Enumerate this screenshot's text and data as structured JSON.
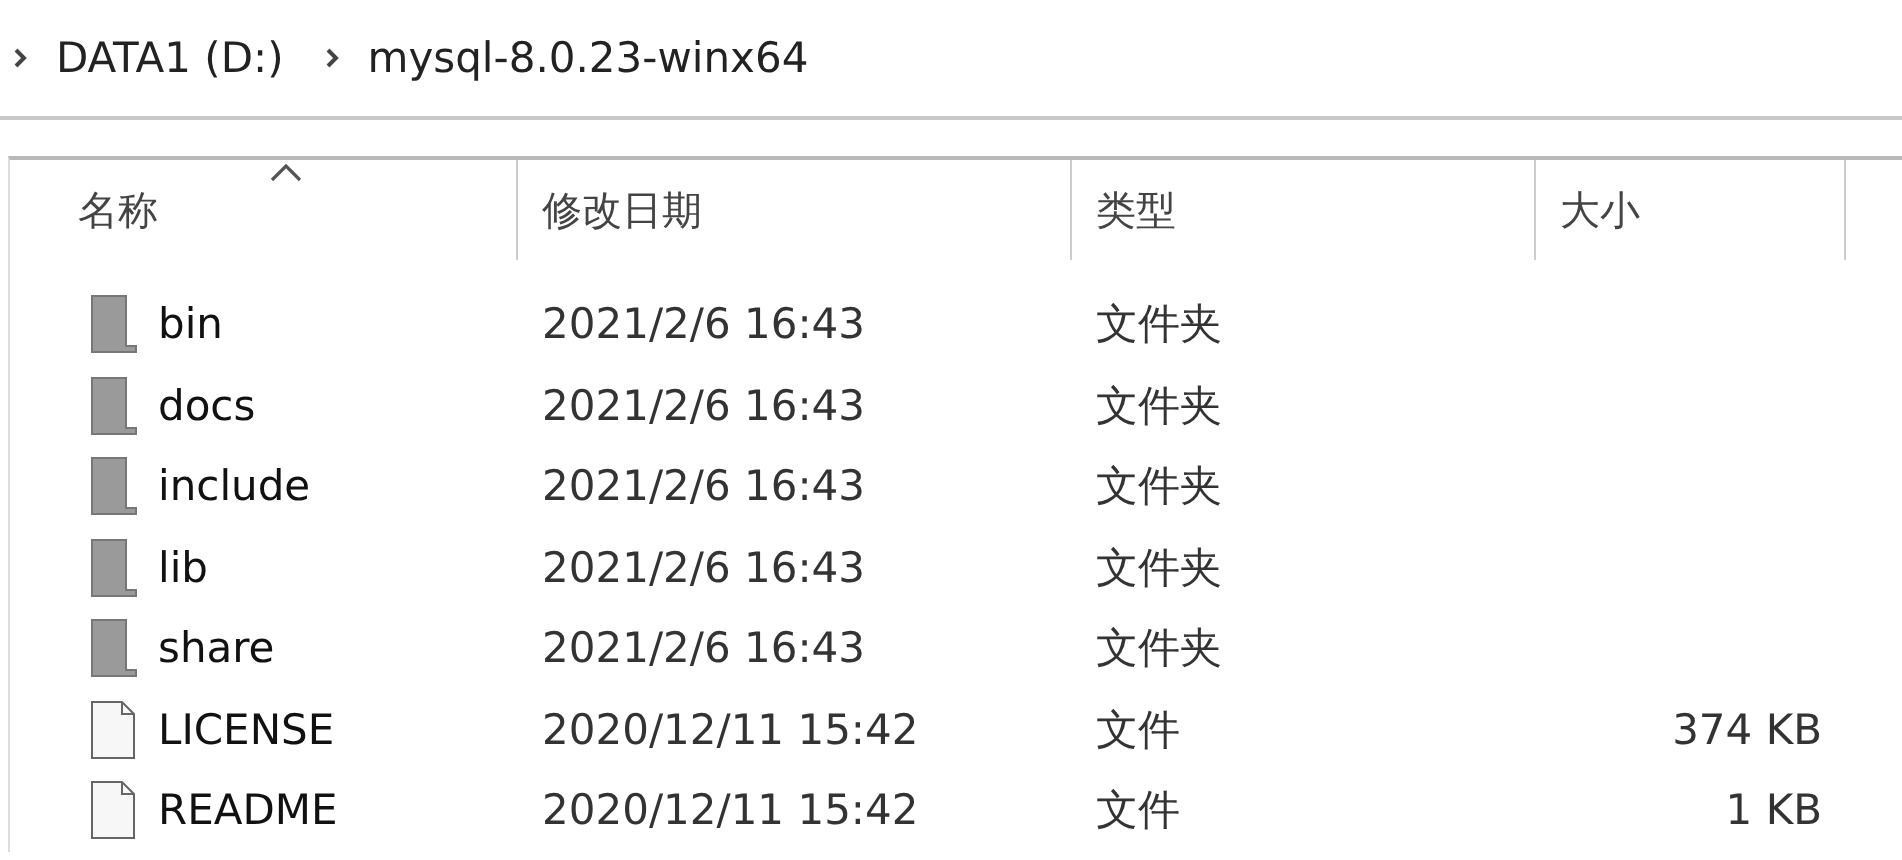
{
  "breadcrumb": [
    "DATA1 (D:)",
    "mysql-8.0.23-winx64"
  ],
  "columns": [
    {
      "label": "名称",
      "sorted": true
    },
    {
      "label": "修改日期",
      "sorted": false
    },
    {
      "label": "类型",
      "sorted": false
    },
    {
      "label": "大小",
      "sorted": false
    }
  ],
  "rows": [
    {
      "kind": "folder",
      "name": "bin",
      "date": "2021/2/6 16:43",
      "type": "文件夹"
    },
    {
      "kind": "folder",
      "name": "docs",
      "date": "2021/2/6 16:43",
      "type": "文件夹"
    },
    {
      "kind": "folder",
      "name": "include",
      "date": "2021/2/6 16:43",
      "type": "文件夹"
    },
    {
      "kind": "folder",
      "name": "lib",
      "date": "2021/2/6 16:43",
      "type": "文件夹"
    },
    {
      "kind": "folder",
      "name": "share",
      "date": "2021/2/6 16:43",
      "type": "文件夹"
    },
    {
      "kind": "file",
      "name": "LICENSE",
      "date": "2020/12/11 15:42",
      "type": "文件",
      "size": "374 KB"
    },
    {
      "kind": "file",
      "name": "README",
      "date": "2020/12/11 15:42",
      "type": "文件",
      "size": "1 KB"
    }
  ]
}
